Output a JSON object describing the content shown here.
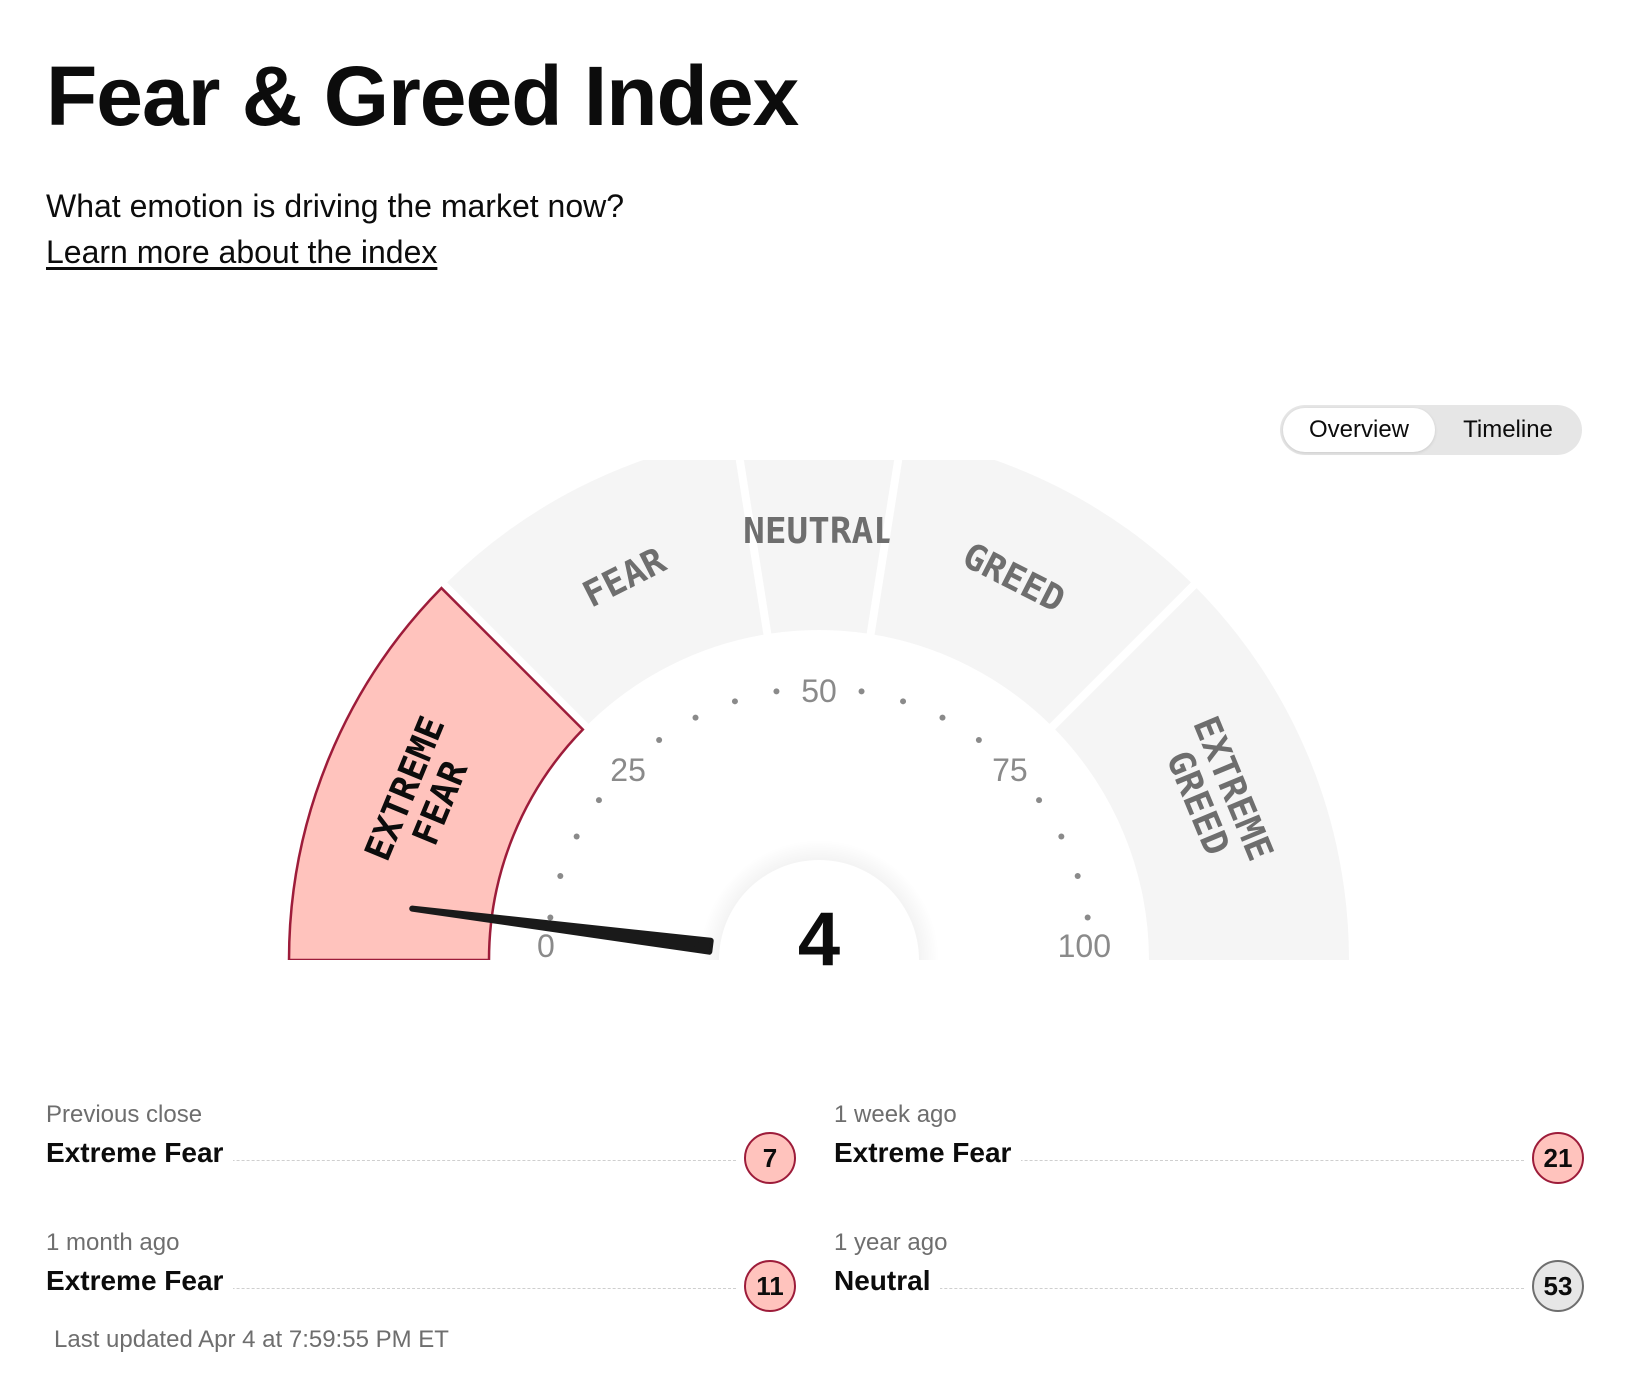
{
  "header": {
    "title": "Fear & Greed Index",
    "subtitle": "What emotion is driving the market now?",
    "learn_more": "Learn more about the index"
  },
  "view_toggle": {
    "options": [
      "Overview",
      "Timeline"
    ],
    "selected": "Overview"
  },
  "gauge": {
    "value": 4,
    "value_label": "4",
    "min": 0,
    "max": 100,
    "scale_labels": [
      "0",
      "25",
      "50",
      "75",
      "100"
    ],
    "scale_values": [
      0,
      25,
      50,
      75,
      100
    ],
    "active_segment": "EXTREME FEAR",
    "segments": [
      {
        "label_lines": [
          "EXTREME",
          "FEAR"
        ],
        "from": 0,
        "to": 25
      },
      {
        "label_lines": [
          "FEAR"
        ],
        "from": 25,
        "to": 45
      },
      {
        "label_lines": [
          "NEUTRAL"
        ],
        "from": 45,
        "to": 55
      },
      {
        "label_lines": [
          "GREED"
        ],
        "from": 55,
        "to": 75
      },
      {
        "label_lines": [
          "EXTREME",
          "GREED"
        ],
        "from": 75,
        "to": 100
      }
    ],
    "colors": {
      "segment": "#f5f5f5",
      "active_fill": "#ffc3bd",
      "active_stroke": "#9d1c3a",
      "segment_text": "#6e6e6e",
      "active_text": "#0c0c0c",
      "needle": "#1a1a1a",
      "scale_text": "#8a8a8a"
    }
  },
  "history": [
    {
      "period": "Previous close",
      "rating": "Extreme Fear",
      "value": "7",
      "tone": "fear"
    },
    {
      "period": "1 week ago",
      "rating": "Extreme Fear",
      "value": "21",
      "tone": "fear"
    },
    {
      "period": "1 month ago",
      "rating": "Extreme Fear",
      "value": "11",
      "tone": "fear"
    },
    {
      "period": "1 year ago",
      "rating": "Neutral",
      "value": "53",
      "tone": "neutral"
    }
  ],
  "last_updated": "Last updated Apr 4 at 7:59:55 PM ET"
}
